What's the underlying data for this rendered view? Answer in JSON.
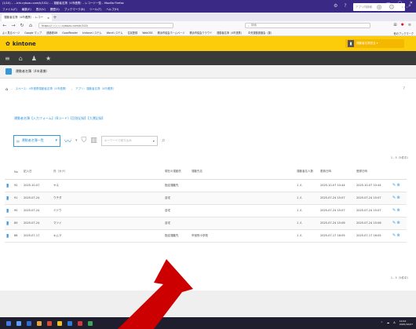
{
  "window": {
    "title": "(1/10) – ...Ichi.cybozu.com/k/102/… ‑ 運動者名簿（4市連携）‑ レコード一覧 – Mozilla Firefox",
    "controls": [
      "—",
      "▢",
      "✕"
    ]
  },
  "menu": [
    "ファイル(F)",
    "編集(E)",
    "表示(V)",
    "履歴(S)",
    "ブックマーク(B)",
    "ツール(T)",
    "ヘルプ(H)"
  ],
  "tab": {
    "title": "運動者名簿（4市連携）‑ レコー",
    "close": "×",
    "new": "+"
  },
  "nav": {
    "url": "https://○○○○.cybozu.com/k/102/",
    "search_placeholder": "検索"
  },
  "bookmarks": {
    "items": [
      "よく見るページ",
      "Google マップ",
      "連絡帳DB",
      "GoodReader",
      "kintoneシステム",
      "Wordシステム",
      "住民登録",
      "WebCBS",
      "横浜市議会ホームページ",
      "横浜市議会クラウド",
      "運動者名簿（4市連携）",
      "中央運動連絡会（運）"
    ],
    "right": "他のブックマーク"
  },
  "header": {
    "logo": "kintone",
    "user": "運動者名簿担当 ▾"
  },
  "ksearch": {
    "placeholder": "アプリ内検索"
  },
  "app": {
    "name": "運動者名簿（4市連携）"
  },
  "breadcrumb": [
    "スペース：4市連携運動者名簿（4市連携）",
    "アプリ：運動者名簿（4市連携）"
  ],
  "help": "?",
  "link": "運動者名簿【入力フォーム】(Bコード)【回答記録】【大運記録】",
  "toolbar": {
    "view": "運動者名簿一覧",
    "filter_placeholder": "キーワードで絞り込み"
  },
  "pager": {
    "top": "1 - 5（5件中）",
    "bottom": "1 - 5（5件中）"
  },
  "table": {
    "headers": [
      "",
      "No",
      "記入日",
      "氏（カナ）",
      "",
      "現在の運動先",
      "運動先名",
      "",
      "運動者名人数",
      "更新日時",
      "登録日時",
      ""
    ],
    "rows": [
      {
        "no": "92",
        "date": "2025-10-07",
        "kana": "ヤス",
        "status": "指定運動先",
        "place": "",
        "count": "1 人",
        "updated": "2025-10-07 10:44",
        "created": "2025-10-07 10:44"
      },
      {
        "no": "91",
        "date": "2025-07-24",
        "kana": "ウチダ",
        "status": "自宅",
        "place": "",
        "count": "1 人",
        "updated": "2025-07-24 15:07",
        "created": "2025-07-24 15:07"
      },
      {
        "no": "90",
        "date": "2025-07-24",
        "kana": "ミドウ",
        "status": "自宅",
        "place": "",
        "count": "1 人",
        "updated": "2025-07-24 15:07",
        "created": "2025-07-24 15:07"
      },
      {
        "no": "89",
        "date": "2025-07-24",
        "kana": "マツイ",
        "status": "自宅",
        "place": "",
        "count": "1 人",
        "updated": "2025-07-24 15:06",
        "created": "2025-07-24 15:06"
      },
      {
        "no": "88",
        "date": "2025-07-17",
        "kana": "キムラ",
        "status": "指定運動先",
        "place": "市役所小学校",
        "count": "1 人",
        "updated": "2025-07-17 16:05",
        "created": "2025-07-17 16:05"
      }
    ]
  },
  "taskbar": {
    "ime": "A",
    "time": "10:44",
    "date": "2025/10/07"
  },
  "colors": {
    "header": "#fccc0a",
    "accent": "#3498db",
    "darkbar": "#3a3a3a",
    "annotation_arrow": "#cc0000"
  }
}
